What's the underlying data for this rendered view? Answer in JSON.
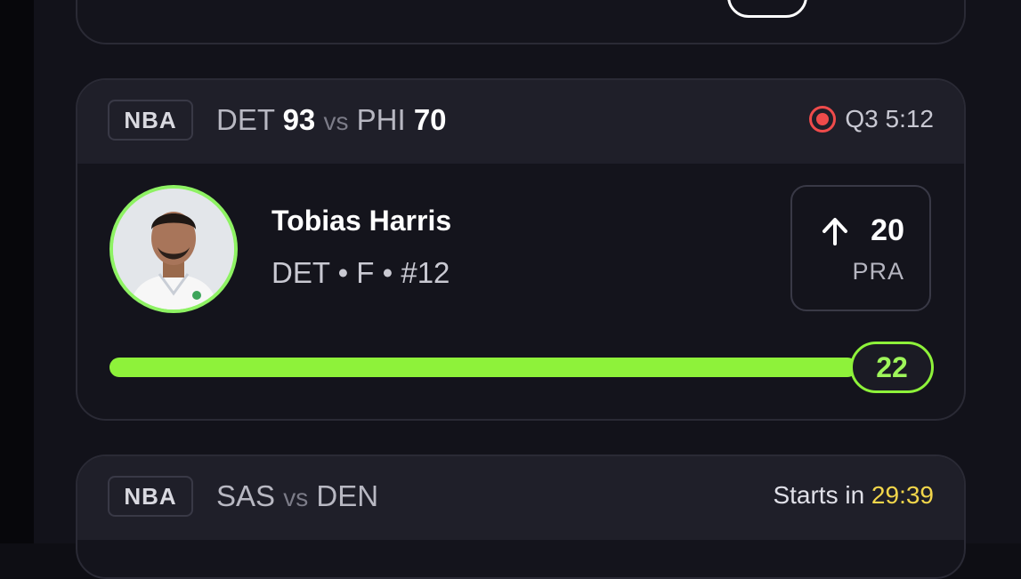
{
  "cards": {
    "live_game": {
      "league": "NBA",
      "team_home": "DET",
      "score_home": "93",
      "vs": "vs",
      "team_away": "PHI",
      "score_away": "70",
      "status": "Q3 5:12",
      "player": {
        "name": "Tobias Harris",
        "meta": "DET • F • #12"
      },
      "prop": {
        "direction": "up",
        "line": "20",
        "stat": "PRA"
      },
      "current_value": "22",
      "progress_fraction": 1.0
    },
    "upcoming_game": {
      "league": "NBA",
      "team_home": "SAS",
      "vs": "vs",
      "team_away": "DEN",
      "starts_label": "Starts in",
      "countdown": "29:39"
    }
  },
  "colors": {
    "accent_green": "#8ef23a",
    "live_red": "#ef4b4b",
    "countdown_yellow": "#f2d64b"
  }
}
